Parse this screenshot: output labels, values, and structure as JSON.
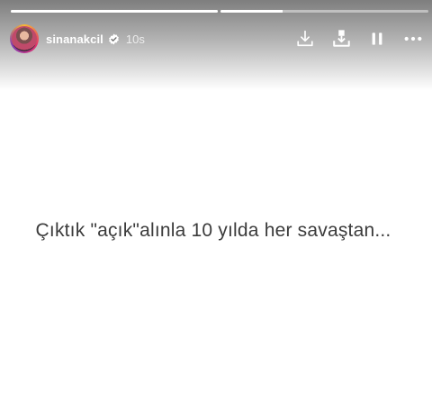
{
  "story": {
    "progress": [
      1.0,
      0.3
    ],
    "author": {
      "username": "sinanakcil",
      "verified": true,
      "time_ago": "10s"
    },
    "actions": {
      "download_icon": "download-icon",
      "save_icon": "save-to-device-icon",
      "pause_icon": "pause-icon",
      "more_icon": "more-options-icon"
    },
    "text": "Çıktık \"açık\"alınla 10 yılda her savaştan..."
  },
  "colors": {
    "text": "#3b3b3b",
    "background": "#ffffff",
    "header_text": "#ffffff"
  }
}
